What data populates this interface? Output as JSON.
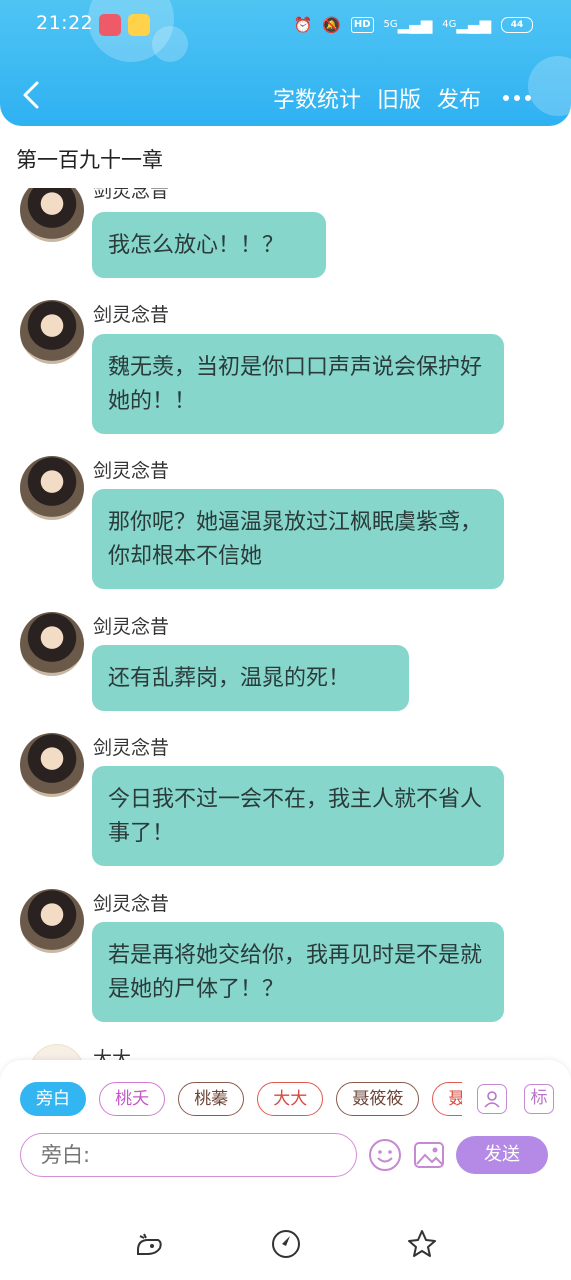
{
  "status_bar": {
    "time": "21:22",
    "network_5g": "5G",
    "network_4g": "4G",
    "hd_label": "HD",
    "battery": "44"
  },
  "toolbar": {
    "word_count_label": "字数统计",
    "old_version_label": "旧版",
    "publish_label": "发布"
  },
  "chapter_title": "第一百九十一章",
  "messages": [
    {
      "sender": "剑灵念昔",
      "text": "我怎么放心！！？"
    },
    {
      "sender": "剑灵念昔",
      "text": "魏无羡，当初是你口口声声说会保护好她的！！"
    },
    {
      "sender": "剑灵念昔",
      "text": "那你呢？她逼温晁放过江枫眠虞紫鸢，你却根本不信她"
    },
    {
      "sender": "剑灵念昔",
      "text": "还有乱葬岗，温晁的死！"
    },
    {
      "sender": "剑灵念昔",
      "text": "今日我不过一会不在，我主人就不省人事了！"
    },
    {
      "sender": "剑灵念昔",
      "text": "若是再将她交给你，我再见时是不是就是她的尸体了！？"
    },
    {
      "sender": "大大",
      "text": ""
    }
  ],
  "roles": [
    "旁白",
    "桃夭",
    "桃蓁",
    "大大",
    "聂筱筱",
    "聂"
  ],
  "character_btn_icon": "person-icon",
  "tag_btn_label": "标",
  "input": {
    "placeholder": "旁白:"
  },
  "send_label": "发送",
  "colors": {
    "header": "#2fb1f2",
    "bubble": "#86d6cc",
    "send": "#b48ae6",
    "active_chip": "#32b5f0"
  }
}
